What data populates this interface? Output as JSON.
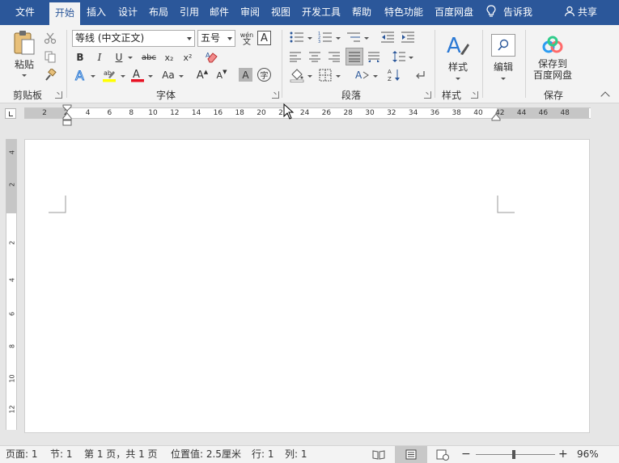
{
  "tabs": [
    {
      "label": "文件"
    },
    {
      "label": "开始"
    },
    {
      "label": "插入"
    },
    {
      "label": "设计"
    },
    {
      "label": "布局"
    },
    {
      "label": "引用"
    },
    {
      "label": "邮件"
    },
    {
      "label": "审阅"
    },
    {
      "label": "视图"
    },
    {
      "label": "开发工具"
    },
    {
      "label": "帮助"
    },
    {
      "label": "特色功能"
    },
    {
      "label": "百度网盘"
    }
  ],
  "active_tab": "开始",
  "tell_me": "告诉我",
  "share": "共享",
  "clipboard": {
    "paste": "粘贴",
    "group": "剪贴板"
  },
  "font": {
    "name": "等线 (中文正文)",
    "size": "五号",
    "group": "字体",
    "bold": "B",
    "italic": "I",
    "underline": "U",
    "strike": "abc",
    "sub": "x₂",
    "sup": "x²",
    "case": "Aa",
    "grow": "A",
    "shrink": "A",
    "phonetic": "wén",
    "border_char": "A",
    "shade_char": "A",
    "enclose": "字"
  },
  "paragraph": {
    "group": "段落"
  },
  "styles": {
    "label": "样式",
    "group": "样式"
  },
  "editing": {
    "label": "编辑"
  },
  "save": {
    "line1": "保存到",
    "line2": "百度网盘",
    "group": "保存"
  },
  "ruler": {
    "h_labels": [
      "2",
      "2",
      "4",
      "6",
      "8",
      "10",
      "12",
      "14",
      "16",
      "18",
      "20",
      "22",
      "24",
      "26",
      "28",
      "30",
      "32",
      "34",
      "36",
      "38",
      "40",
      "42",
      "44",
      "46",
      "48"
    ],
    "v_labels": [
      "4",
      "2",
      "2",
      "4",
      "6",
      "8",
      "10",
      "12"
    ]
  },
  "status": {
    "page": "页面: 1",
    "section": "节: 1",
    "pages": "第 1 页，共 1 页",
    "position": "位置值: 2.5厘米",
    "line": "行: 1",
    "column": "列: 1",
    "zoom": "96%",
    "zoom_level": 0.96
  },
  "colors": {
    "ribbon_tab_bg": "#2b579a",
    "ribbon_bg": "#f3f3f3",
    "highlight": "#ffff00",
    "font_color": "#e81123"
  }
}
